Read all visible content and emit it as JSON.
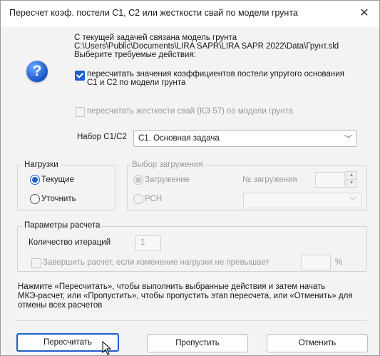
{
  "window": {
    "title": "Пересчет коэф. постели С1, С2 или жесткости свай по модели грунта",
    "close_glyph": "✕"
  },
  "info": {
    "icon": "question-icon",
    "line1": "С текущей задачей связана модель грунта",
    "line2": "C:\\Users\\Public\\Documents\\LIRA SAPR\\LIRA SAPR 2022\\Data\\Грунт.sld",
    "line3": "Выберите требуемые действия:"
  },
  "options": {
    "recalc_c1c2_line1": "пересчитать значения коэффициентов постели упругого основания",
    "recalc_c1c2_line2": "С1 и С2 по модели грунта",
    "recalc_c1c2_checked": true,
    "recalc_piles": "пересчитать жесткости свай (КЭ 57) по модели грунта",
    "recalc_piles_checked": false
  },
  "c1c2_set": {
    "label": "Набор С1/С2",
    "value": "С1. Основная задача"
  },
  "loads": {
    "legend": "Нагрузки",
    "current": "Текущие",
    "refine": "Уточнить",
    "selected": "current"
  },
  "load_choice": {
    "legend": "Выбор загружения",
    "loading": "Загружение",
    "rsn": "РСН",
    "loading_number_label": "№ загружения",
    "loading_number": ""
  },
  "calc_params": {
    "legend": "Параметры расчета",
    "iterations_label": "Количество итераций",
    "iterations_value": "1",
    "finish_label": "Завершить расчет, если изменение нагрузки не превышает",
    "percent": "%"
  },
  "footer_text": {
    "line1": "Нажмите «Пересчитать», чтобы выполнить выбранные действия и затем начать",
    "line2": "МКЭ-расчет, или «Пропустить», чтобы пропустить этап пересчета, или «Отменить» для",
    "line3": "отмены всех расчетов"
  },
  "buttons": {
    "recalc": "Пересчитать",
    "skip": "Пропустить",
    "cancel": "Отменить"
  },
  "colors": {
    "accent": "#1f5fcc",
    "dialog_bg": "#f3f3f3"
  }
}
